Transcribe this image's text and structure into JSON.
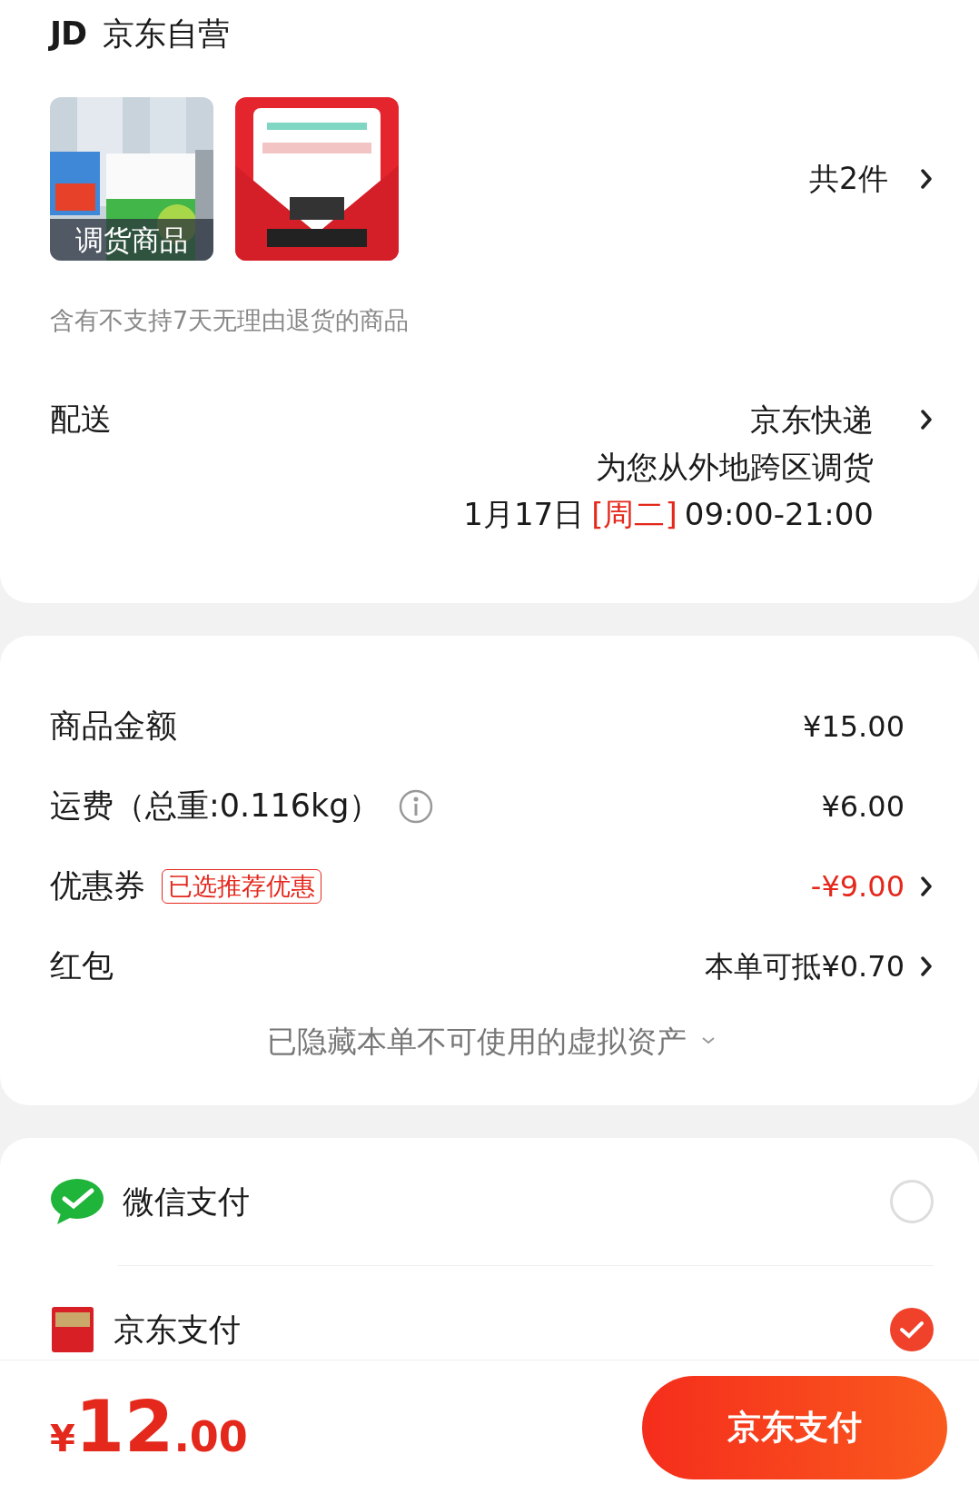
{
  "store": {
    "logo": "JD",
    "name": "京东自营"
  },
  "products": {
    "items": [
      {
        "kind": "picture",
        "badge": "调货商品"
      },
      {
        "kind": "picture"
      }
    ],
    "count": "共2件"
  },
  "notice": "含有不支持7天无理由退货的商品",
  "delivery": {
    "label": "配送",
    "carrier": "京东快递",
    "note": "为您从外地跨区调货",
    "date": "1月17日",
    "weekday": "[周二]",
    "time": "09:00-21:00"
  },
  "summary": {
    "rows": [
      {
        "kind": "plain",
        "label": "商品金额",
        "value": "¥15.00",
        "highlight": false,
        "link": false
      },
      {
        "kind": "info",
        "label": "运费（总重:0.116kg）",
        "value": "¥6.00",
        "highlight": false,
        "link": false
      },
      {
        "kind": "tag",
        "label": "优惠券",
        "tag": "已选推荐优惠",
        "value": "-¥9.00",
        "highlight": true,
        "link": true
      },
      {
        "kind": "plain",
        "label": "红包",
        "value": "本单可抵¥0.70",
        "highlight": false,
        "link": true
      }
    ],
    "hidden_note": "已隐藏本单不可使用的虚拟资产"
  },
  "payment_methods": [
    {
      "kind": "wechat",
      "name": "微信支付",
      "selected": false
    },
    {
      "kind": "jd",
      "name": "京东支付",
      "selected": true
    }
  ],
  "footer": {
    "currency": "¥",
    "amount_int": "12",
    "amount_dec": ".00",
    "button": "京东支付"
  }
}
